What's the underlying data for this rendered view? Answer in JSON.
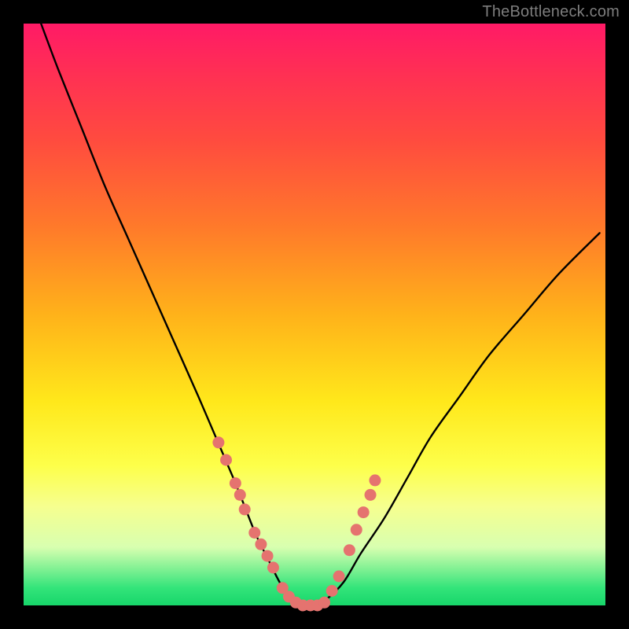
{
  "watermark": "TheBottleneck.com",
  "chart_data": {
    "type": "line",
    "title": "",
    "xlabel": "",
    "ylabel": "",
    "xlim": [
      0,
      100
    ],
    "ylim": [
      0,
      100
    ],
    "series": [
      {
        "name": "bottleneck-curve",
        "x": [
          3,
          6,
          10,
          14,
          18,
          22,
          26,
          30,
          33,
          36,
          38,
          40,
          42,
          44,
          46,
          48,
          50,
          52,
          55,
          58,
          62,
          66,
          70,
          75,
          80,
          86,
          92,
          99
        ],
        "y": [
          100,
          92,
          82,
          72,
          63,
          54,
          45,
          36,
          29,
          22,
          17,
          12,
          8,
          4,
          1,
          0,
          0,
          1,
          4,
          9,
          15,
          22,
          29,
          36,
          43,
          50,
          57,
          64
        ]
      }
    ],
    "markers": {
      "name": "highlight-dots",
      "color": "#e5736f",
      "x": [
        33.5,
        34.8,
        36.4,
        37.2,
        38.0,
        39.7,
        40.8,
        41.9,
        42.9,
        44.5,
        45.6,
        46.8,
        48.0,
        49.3,
        50.5,
        51.7,
        53.0,
        54.2,
        56.0,
        57.2,
        58.4,
        59.6,
        60.4
      ],
      "y": [
        28.0,
        25.0,
        21.0,
        19.0,
        16.5,
        12.5,
        10.5,
        8.5,
        6.5,
        3.0,
        1.5,
        0.5,
        0.0,
        0.0,
        0.0,
        0.5,
        2.5,
        5.0,
        9.5,
        13.0,
        16.0,
        19.0,
        21.5
      ]
    }
  }
}
